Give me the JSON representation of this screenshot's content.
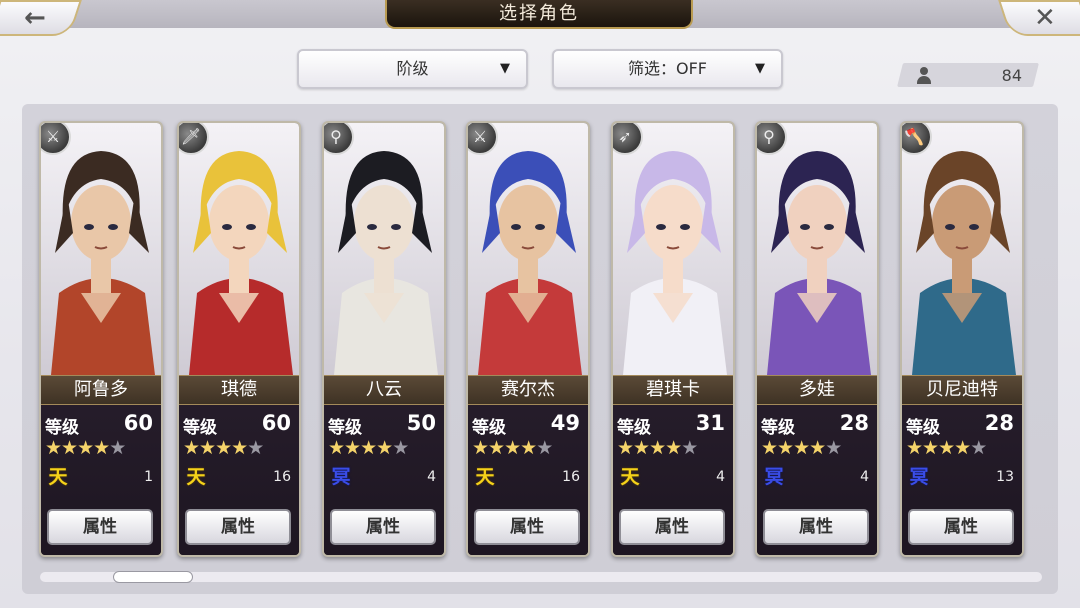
{
  "header": {
    "title": "选择角色",
    "back_icon": "←",
    "close_icon": "✕"
  },
  "filters": {
    "rank_label": "阶级",
    "filter_label": "筛选：OFF",
    "chevron": "▼"
  },
  "roster_count": "84",
  "attr_label": "属性",
  "level_label": "等级",
  "scroll_position": 0.08,
  "characters": [
    {
      "name": "阿鲁多",
      "level": "60",
      "stars": 4,
      "tier": "天",
      "tier_color": "gold",
      "tier_count": "1",
      "weapon": "sword-icon",
      "weapon_glyph": "⚔",
      "palette": [
        "#3b2b22",
        "#b2452a",
        "#e9c7a8"
      ]
    },
    {
      "name": "琪德",
      "level": "60",
      "stars": 4,
      "tier": "天",
      "tier_color": "gold",
      "tier_count": "16",
      "weapon": "knife-icon",
      "weapon_glyph": "🗡",
      "palette": [
        "#e9c23a",
        "#b62b2b",
        "#f3d6bd"
      ]
    },
    {
      "name": "八云",
      "level": "50",
      "stars": 4,
      "tier": "冥",
      "tier_color": "blue",
      "tier_count": "4",
      "weapon": "staff-icon",
      "weapon_glyph": "⚲",
      "palette": [
        "#1c1c22",
        "#e8e6e0",
        "#ede0d2"
      ]
    },
    {
      "name": "赛尔杰",
      "level": "49",
      "stars": 4,
      "tier": "天",
      "tier_color": "gold",
      "tier_count": "16",
      "weapon": "sword-icon",
      "weapon_glyph": "⚔",
      "palette": [
        "#3b4fb8",
        "#c43a3a",
        "#e7c3a1"
      ]
    },
    {
      "name": "碧琪卡",
      "level": "31",
      "stars": 4,
      "tier": "天",
      "tier_color": "gold",
      "tier_count": "4",
      "weapon": "bow-icon",
      "weapon_glyph": "➶",
      "palette": [
        "#c8b8e8",
        "#f1f0f6",
        "#f6dcca"
      ]
    },
    {
      "name": "多娃",
      "level": "28",
      "stars": 4,
      "tier": "冥",
      "tier_color": "blue",
      "tier_count": "4",
      "weapon": "staff-icon",
      "weapon_glyph": "⚲",
      "palette": [
        "#2c2452",
        "#7a55b8",
        "#f0d1bf"
      ]
    },
    {
      "name": "贝尼迪特",
      "level": "28",
      "stars": 4,
      "tier": "冥",
      "tier_color": "blue",
      "tier_count": "13",
      "weapon": "axe-icon",
      "weapon_glyph": "🪓",
      "palette": [
        "#6a4428",
        "#2f6a8a",
        "#c99b76"
      ]
    }
  ]
}
